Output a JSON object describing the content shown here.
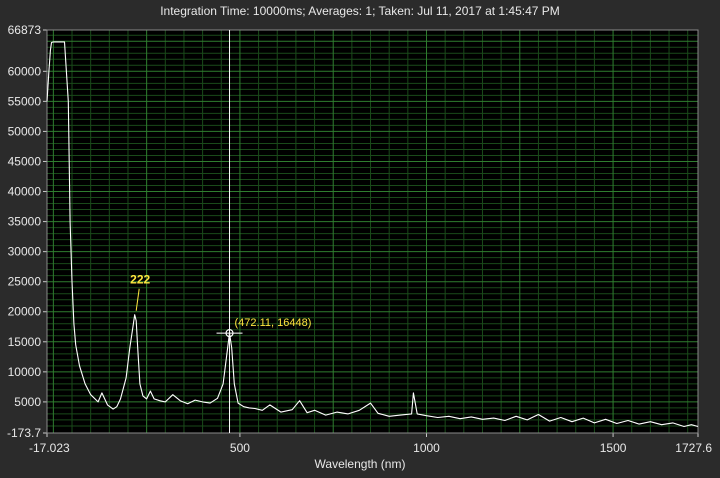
{
  "title": "Integration Time: 10000ms;  Averages: 1;  Taken: Jul 11, 2017 at 1:45:47 PM",
  "colors": {
    "background": "#2b2b2b",
    "plot_bg": "#000000",
    "grid_major": "#2f7d2f",
    "grid_minor": "#1a4a1a",
    "trace": "#ffffff",
    "cursor": "#ffffff",
    "annotation": "#ffe640"
  },
  "chart_data": {
    "type": "line",
    "xlabel": "Wavelength (nm)",
    "ylabel": "",
    "xlim": [
      -17.023,
      1727.6
    ],
    "ylim": [
      -173.7,
      66873
    ],
    "grid": true,
    "x_ticks": [
      {
        "value": -17.023,
        "label": "-17.023"
      },
      {
        "value": 500,
        "label": "500"
      },
      {
        "value": 1000,
        "label": "1000"
      },
      {
        "value": 1500,
        "label": "1500"
      },
      {
        "value": 1727.6,
        "label": "1727.6"
      }
    ],
    "y_ticks": [
      {
        "value": 66873,
        "label": "66873"
      },
      {
        "value": 60000,
        "label": "60000"
      },
      {
        "value": 55000,
        "label": "55000"
      },
      {
        "value": 50000,
        "label": "50000"
      },
      {
        "value": 45000,
        "label": "45000"
      },
      {
        "value": 40000,
        "label": "40000"
      },
      {
        "value": 35000,
        "label": "35000"
      },
      {
        "value": 30000,
        "label": "30000"
      },
      {
        "value": 25000,
        "label": "25000"
      },
      {
        "value": 20000,
        "label": "20000"
      },
      {
        "value": 15000,
        "label": "15000"
      },
      {
        "value": 10000,
        "label": "10000"
      },
      {
        "value": 5000,
        "label": "5000"
      },
      {
        "value": -173.7,
        "label": "-173.7"
      }
    ],
    "series": [
      {
        "x": [
          -17.0,
          -12,
          -8,
          -5,
          0,
          10,
          30,
          40,
          45,
          50,
          55,
          60,
          70,
          85,
          100,
          120,
          130,
          145,
          160,
          170,
          180,
          195,
          205,
          212,
          218,
          222,
          226,
          232,
          240,
          250,
          260,
          270,
          285,
          300,
          320,
          340,
          360,
          380,
          400,
          420,
          440,
          455,
          465,
          472.11,
          478,
          485,
          495,
          510,
          525,
          540,
          560,
          580,
          610,
          640,
          660,
          680,
          700,
          730,
          760,
          790,
          820,
          850,
          870,
          900,
          930,
          960,
          965,
          975,
          1000,
          1030,
          1060,
          1090,
          1120,
          1150,
          1180,
          1210,
          1240,
          1270,
          1300,
          1330,
          1360,
          1390,
          1420,
          1450,
          1480,
          1510,
          1540,
          1570,
          1600,
          1630,
          1660,
          1690,
          1710,
          1727.6
        ],
        "y": [
          55000,
          60000,
          63500,
          64800,
          64900,
          64900,
          64900,
          55000,
          35000,
          25000,
          18000,
          14500,
          11000,
          8000,
          6200,
          5000,
          6500,
          4500,
          3800,
          4200,
          5500,
          9000,
          14000,
          17000,
          19500,
          18500,
          14000,
          8000,
          6000,
          5500,
          6800,
          5500,
          5200,
          5000,
          6200,
          5200,
          4700,
          5300,
          5000,
          4800,
          5600,
          8000,
          13000,
          16448,
          14000,
          8000,
          4800,
          4200,
          4000,
          3900,
          3600,
          4500,
          3300,
          3700,
          5200,
          3200,
          3600,
          2800,
          3300,
          3000,
          3600,
          4800,
          3100,
          2600,
          2800,
          3000,
          6500,
          3000,
          2700,
          2400,
          2600,
          2200,
          2500,
          2100,
          2300,
          1900,
          2600,
          2000,
          2900,
          1800,
          2400,
          1700,
          2300,
          1500,
          2100,
          1400,
          1900,
          1300,
          1700,
          1200,
          1500,
          900,
          1200,
          900
        ]
      }
    ],
    "annotations": [
      {
        "text": "222",
        "x": 222,
        "y": 19500
      },
      {
        "text": "(472.11, 16448)",
        "x": 472.11,
        "y": 16448
      }
    ],
    "cursor_x": 472.11
  }
}
